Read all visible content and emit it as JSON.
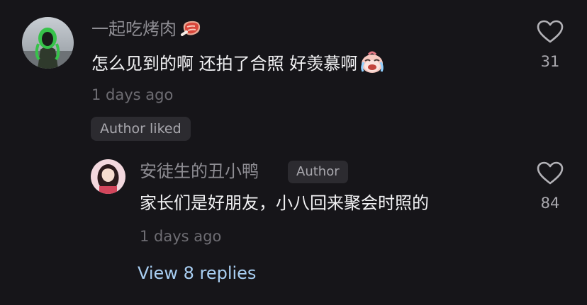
{
  "comment": {
    "username": "一起吃烤肉",
    "username_emoji_icon": "meat-icon",
    "text": "怎么见到的啊 还拍了合照 好羡慕啊",
    "text_emoji_icon": "crying-face-icon",
    "time": "1 days ago",
    "badge": "Author liked",
    "likes": "31"
  },
  "reply": {
    "username": "安徒生的丑小鸭",
    "author_tag": "Author",
    "text": "家长们是好朋友，小八回来聚会时照的",
    "time": "1 days ago",
    "likes": "84"
  },
  "view_replies": "View 8 replies",
  "colors": {
    "background": "#161519",
    "primary_text": "#f2f2f4",
    "secondary_text": "#8e8d93",
    "link": "#a9cff3"
  }
}
